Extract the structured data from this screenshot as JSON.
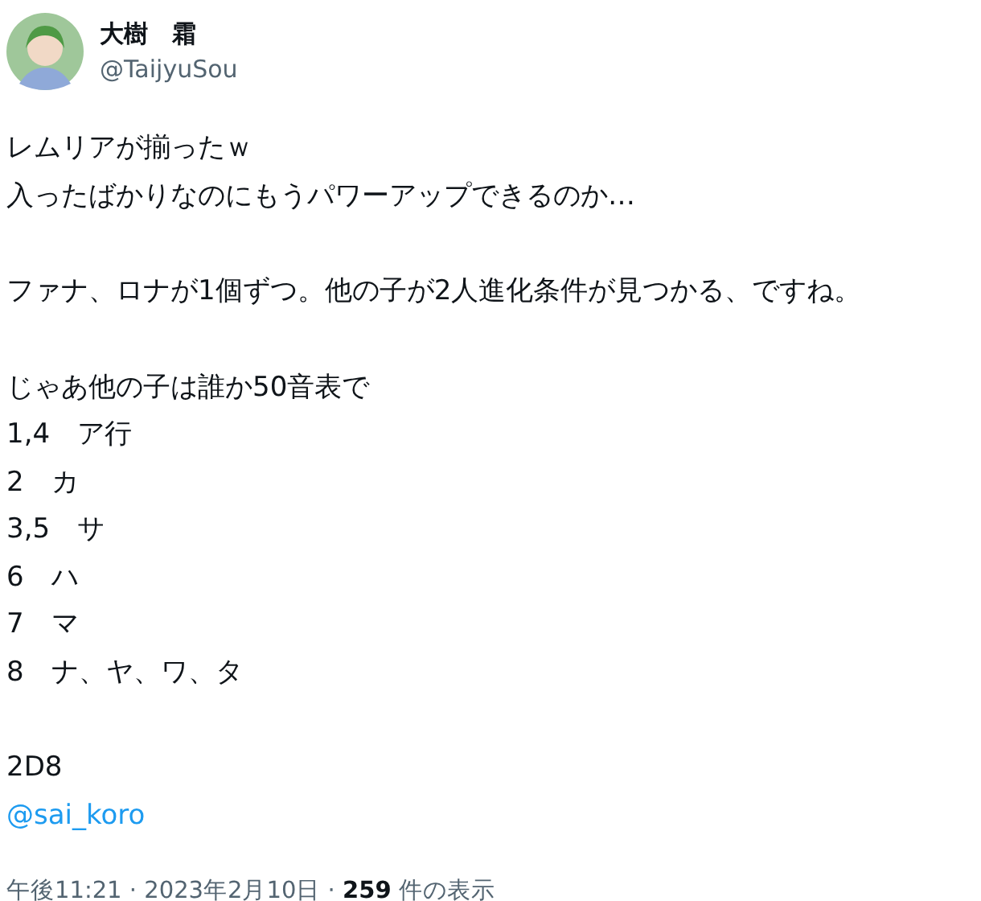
{
  "author": {
    "name": "大樹　霜",
    "handle": "@TaijyuSou"
  },
  "paragraphs": [
    {
      "lines": [
        {
          "kind": "text",
          "text": "レムリアが揃ったｗ"
        },
        {
          "kind": "text",
          "text": "入ったばかりなのにもうパワーアップできるのか…"
        }
      ]
    },
    {
      "lines": [
        {
          "kind": "text",
          "text": "ファナ、ロナが1個ずつ。他の子が2人進化条件が見つかる、ですね。"
        }
      ]
    },
    {
      "lines": [
        {
          "kind": "text",
          "text": "じゃあ他の子は誰か50音表で"
        },
        {
          "kind": "text",
          "text": "1,4　ア行"
        },
        {
          "kind": "text",
          "text": "2　カ"
        },
        {
          "kind": "text",
          "text": "3,5　サ"
        },
        {
          "kind": "text",
          "text": "6　ハ"
        },
        {
          "kind": "text",
          "text": "7　マ"
        },
        {
          "kind": "text",
          "text": "8　ナ、ヤ、ワ、タ"
        }
      ]
    },
    {
      "lines": [
        {
          "kind": "text",
          "text": "2D8"
        },
        {
          "kind": "mention",
          "text": "@sai_koro"
        }
      ]
    }
  ],
  "meta": "午後11:21 · 2023年2月10日 · **259** 件の表示"
}
